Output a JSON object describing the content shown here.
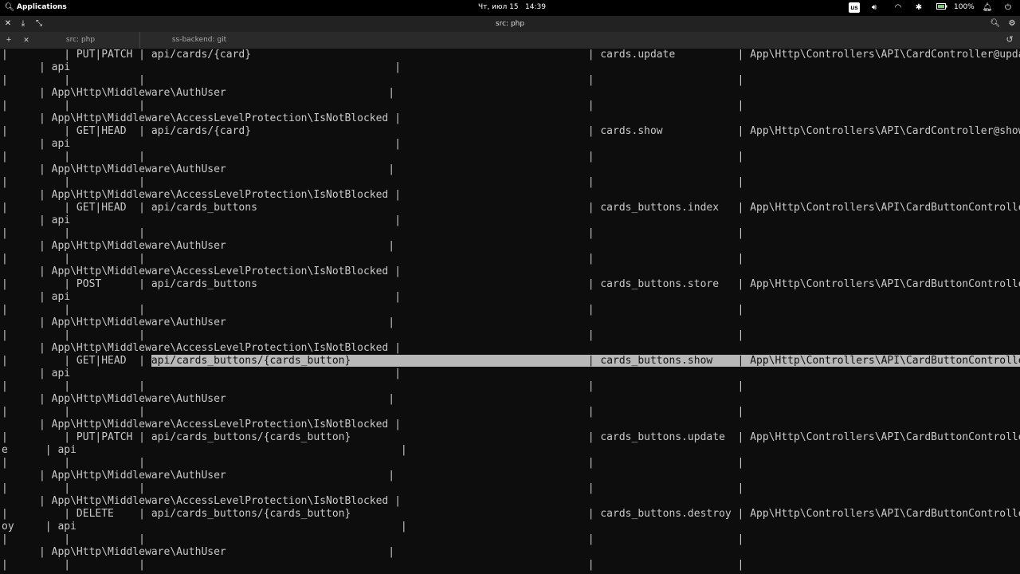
{
  "topbar": {
    "applications": "Applications",
    "datetime_day": "Чт, июл 15",
    "datetime_time": "14:39",
    "keyboard_layout": "us",
    "battery": "100%"
  },
  "window": {
    "title": "src: php"
  },
  "tabs": [
    {
      "label": "src: php"
    },
    {
      "label": "ss-backend: git"
    }
  ],
  "terminal": {
    "lines": [
      "|         | PUT|PATCH | api/cards/{card}                                                      | cards.update          | App\\Http\\Controllers\\API\\CardController@update",
      "      | api                                                    |",
      "|         |           |                                                                       |                       |",
      "      | App\\Http\\Middleware\\AuthUser                          |",
      "|         |           |                                                                       |                       |",
      "      | App\\Http\\Middleware\\AccessLevelProtection\\IsNotBlocked |",
      "|         | GET|HEAD  | api/cards/{card}                                                      | cards.show            | App\\Http\\Controllers\\API\\CardController@show",
      "      | api                                                    |",
      "|         |           |                                                                       |                       |",
      "      | App\\Http\\Middleware\\AuthUser                          |",
      "|         |           |                                                                       |                       |",
      "      | App\\Http\\Middleware\\AccessLevelProtection\\IsNotBlocked |",
      "|         | GET|HEAD  | api/cards_buttons                                                     | cards_buttons.index   | App\\Http\\Controllers\\API\\CardButtonController@index",
      "      | api                                                    |",
      "|         |           |                                                                       |                       |",
      "      | App\\Http\\Middleware\\AuthUser                          |",
      "|         |           |                                                                       |                       |",
      "      | App\\Http\\Middleware\\AccessLevelProtection\\IsNotBlocked |",
      "|         | POST      | api/cards_buttons                                                     | cards_buttons.store   | App\\Http\\Controllers\\API\\CardButtonController@store",
      "      | api                                                    |",
      "|         |           |                                                                       |                       |",
      "      | App\\Http\\Middleware\\AuthUser                          |",
      "|         |           |                                                                       |                       |",
      "      | App\\Http\\Middleware\\AccessLevelProtection\\IsNotBlocked |",
      "|         | GET|HEAD  | api/cards_buttons/{cards_button}                                      | cards_buttons.show    | App\\Http\\Controllers\\API\\CardButtonController@show",
      "      | api                                                    |",
      "|         |           |                                                                       |                       |",
      "      | App\\Http\\Middleware\\AuthUser                          |",
      "|         |           |                                                                       |                       |",
      "      | App\\Http\\Middleware\\AccessLevelProtection\\IsNotBlocked |",
      "|         | PUT|PATCH | api/cards_buttons/{cards_button}                                      | cards_buttons.update  | App\\Http\\Controllers\\API\\CardButtonController@updat",
      "e      | api                                                    |",
      "|         |           |                                                                       |                       |",
      "      | App\\Http\\Middleware\\AuthUser                          |",
      "|         |           |                                                                       |                       |",
      "      | App\\Http\\Middleware\\AccessLevelProtection\\IsNotBlocked |",
      "|         | DELETE    | api/cards_buttons/{cards_button}                                      | cards_buttons.destroy | App\\Http\\Controllers\\API\\CardButtonController@destr",
      "oy     | api                                                    |",
      "|         |           |                                                                       |                       |",
      "      | App\\Http\\Middleware\\AuthUser                          |",
      "|         |           |                                                                       |                       |"
    ],
    "highlight_row": 24
  }
}
